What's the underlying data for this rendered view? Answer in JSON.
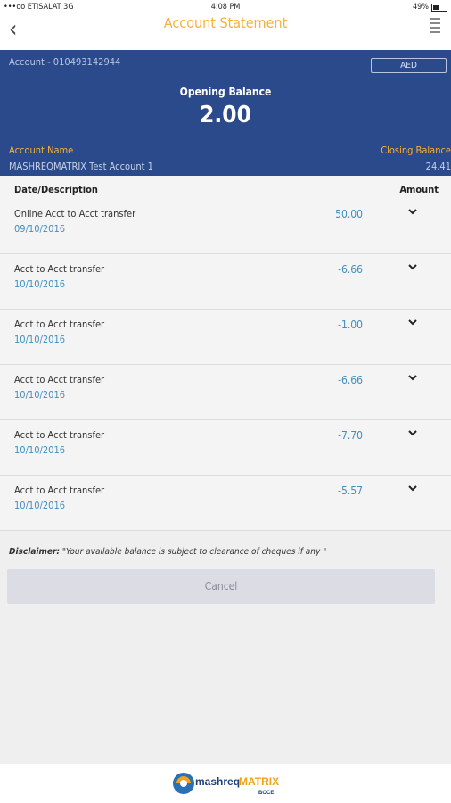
{
  "status_bar": {
    "carrier": "•••oo ETISALAT  3G",
    "time": "4:08 PM",
    "battery": "49%"
  },
  "nav": {
    "title": "Account Statement"
  },
  "account": {
    "number_label": "Account - 010493142944",
    "currency": "AED",
    "opening_balance_label": "Opening Balance",
    "opening_balance": "2.00",
    "name_label": "Account Name",
    "name": "MASHREQMATRIX Test Account 1",
    "closing_balance_label": "Closing Balance",
    "closing_balance": "24.41"
  },
  "table": {
    "col_desc": "Date/Description",
    "col_amount": "Amount",
    "rows": [
      {
        "desc": "Online Acct to Acct transfer",
        "date": "09/10/2016",
        "amount": "50.00"
      },
      {
        "desc": "Acct to Acct transfer",
        "date": "10/10/2016",
        "amount": "-6.66"
      },
      {
        "desc": "Acct to Acct transfer",
        "date": "10/10/2016",
        "amount": "-1.00"
      },
      {
        "desc": "Acct to Acct transfer",
        "date": "10/10/2016",
        "amount": "-6.66"
      },
      {
        "desc": "Acct to Acct transfer",
        "date": "10/10/2016",
        "amount": "-7.70"
      },
      {
        "desc": "Acct to Acct transfer",
        "date": "10/10/2016",
        "amount": "-5.57"
      }
    ]
  },
  "disclaimer": {
    "label": "Disclaimer:",
    "text": "\"Your available balance is subject to clearance of cheques if any \""
  },
  "cancel_label": "Cancel",
  "footer": {
    "logo_text": "mashreqMATRIX",
    "logo_sub": "BOCE"
  },
  "colors": {
    "header_bg": "#2b4a8c",
    "accent": "#f4b23a",
    "amount": "#3f8fc0"
  }
}
